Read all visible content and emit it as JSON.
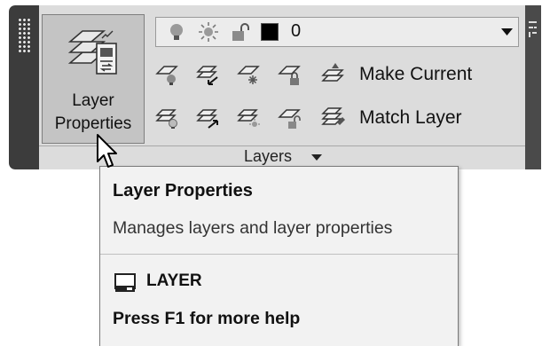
{
  "ribbon": {
    "panel_title": "Layers",
    "big_button": {
      "label_line1": "Layer",
      "label_line2": "Properties",
      "icon": "layer-properties-icon"
    },
    "layer_dropdown": {
      "current_layer": "0",
      "state_icons": [
        "lightbulb-on-icon",
        "sun-thaw-icon",
        "padlock-unlocked-icon"
      ],
      "color_swatch": "#000000"
    },
    "row1": {
      "icons": [
        "layer-off-icon",
        "layer-isolate-icon",
        "layer-freeze-icon",
        "layer-lock-icon"
      ],
      "action_icon": "make-current-icon",
      "action_label": "Make Current"
    },
    "row2": {
      "icons": [
        "layer-on-icon",
        "layer-unisolate-icon",
        "layer-thaw-icon",
        "layer-unlock-icon"
      ],
      "action_icon": "match-layer-icon",
      "action_label": "Match Layer"
    }
  },
  "tooltip": {
    "title": "Layer Properties",
    "description": "Manages layers and layer properties",
    "command": "LAYER",
    "command_icon": "command-line-icon",
    "help": "Press F1 for more help"
  },
  "colors": {
    "panel_bg": "#dcdcdc",
    "panel_frame": "#3c3c3c",
    "tooltip_bg": "#f2f2f2"
  }
}
